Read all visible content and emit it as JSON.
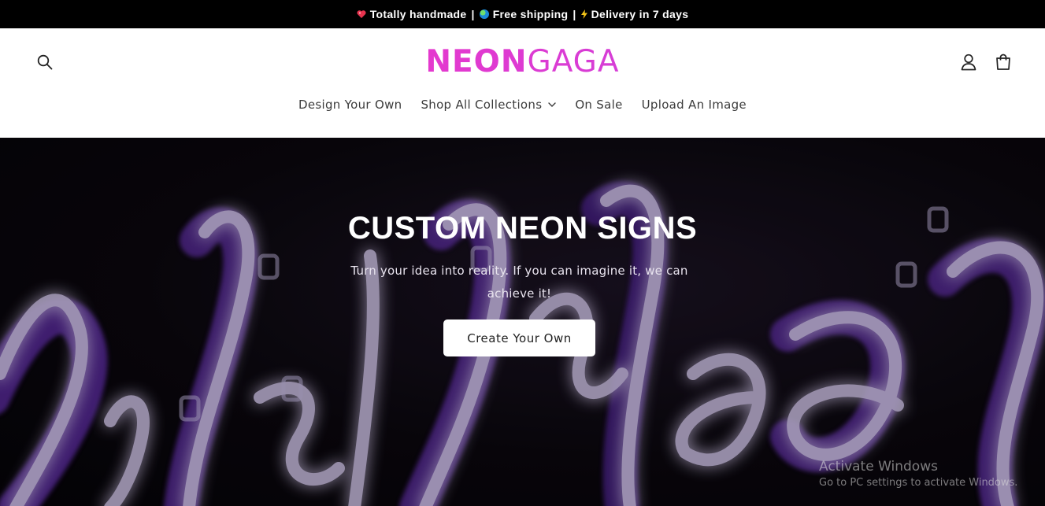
{
  "announcement": {
    "item1": "Totally handmade",
    "item2": "Free shipping",
    "item3": "Delivery in 7 days",
    "separator": "|"
  },
  "header": {
    "logo_bold": "NEON",
    "logo_light": "GAGA",
    "logo_colors": [
      "#ff2fbf",
      "#b646e6"
    ],
    "nav": [
      {
        "label": "Design Your Own"
      },
      {
        "label": "Shop All Collections",
        "has_dropdown": true
      },
      {
        "label": "On Sale"
      },
      {
        "label": "Upload An Image"
      }
    ],
    "icons": [
      "search-icon",
      "account-icon",
      "cart-icon"
    ]
  },
  "hero": {
    "title": "CUSTOM NEON SIGNS",
    "subtitle": "Turn your idea into reality. If you can imagine it, we can achieve it!",
    "button_label": "Create Your Own",
    "neon_colors": [
      "#c7b9de",
      "#6a35b8",
      "#3a1b6b"
    ]
  },
  "watermark": {
    "title": "Activate Windows",
    "subtitle": "Go to PC settings to activate Windows."
  }
}
